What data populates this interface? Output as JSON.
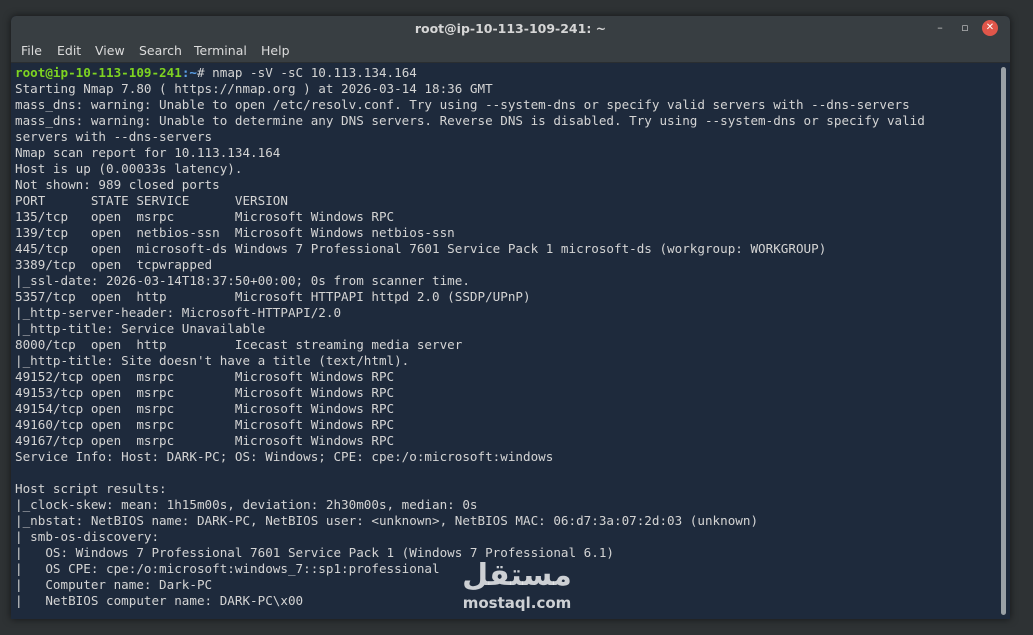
{
  "window": {
    "title": "root@ip-10-113-109-241: ~",
    "buttons": {
      "minimize": "–",
      "maximize": "▫",
      "close": "✕"
    }
  },
  "menu": [
    "File",
    "Edit",
    "View",
    "Search",
    "Terminal",
    "Help"
  ],
  "prompt": {
    "user_host": "root@ip-10-113-109-241",
    "path": ":~",
    "command": "# nmap -sV -sC 10.113.134.164"
  },
  "output": [
    "Starting Nmap 7.80 ( https://nmap.org ) at 2026-03-14 18:36 GMT",
    "mass_dns: warning: Unable to open /etc/resolv.conf. Try using --system-dns or specify valid servers with --dns-servers",
    "mass_dns: warning: Unable to determine any DNS servers. Reverse DNS is disabled. Try using --system-dns or specify valid",
    "servers with --dns-servers",
    "Nmap scan report for 10.113.134.164",
    "Host is up (0.00033s latency).",
    "Not shown: 989 closed ports",
    "PORT      STATE SERVICE      VERSION",
    "135/tcp   open  msrpc        Microsoft Windows RPC",
    "139/tcp   open  netbios-ssn  Microsoft Windows netbios-ssn",
    "445/tcp   open  microsoft-ds Windows 7 Professional 7601 Service Pack 1 microsoft-ds (workgroup: WORKGROUP)",
    "3389/tcp  open  tcpwrapped",
    "|_ssl-date: 2026-03-14T18:37:50+00:00; 0s from scanner time.",
    "5357/tcp  open  http         Microsoft HTTPAPI httpd 2.0 (SSDP/UPnP)",
    "|_http-server-header: Microsoft-HTTPAPI/2.0",
    "|_http-title: Service Unavailable",
    "8000/tcp  open  http         Icecast streaming media server",
    "|_http-title: Site doesn't have a title (text/html).",
    "49152/tcp open  msrpc        Microsoft Windows RPC",
    "49153/tcp open  msrpc        Microsoft Windows RPC",
    "49154/tcp open  msrpc        Microsoft Windows RPC",
    "49160/tcp open  msrpc        Microsoft Windows RPC",
    "49167/tcp open  msrpc        Microsoft Windows RPC",
    "Service Info: Host: DARK-PC; OS: Windows; CPE: cpe:/o:microsoft:windows",
    "",
    "Host script results:",
    "|_clock-skew: mean: 1h15m00s, deviation: 2h30m00s, median: 0s",
    "|_nbstat: NetBIOS name: DARK-PC, NetBIOS user: <unknown>, NetBIOS MAC: 06:d7:3a:07:2d:03 (unknown)",
    "| smb-os-discovery:",
    "|   OS: Windows 7 Professional 7601 Service Pack 1 (Windows 7 Professional 6.1)",
    "|   OS CPE: cpe:/o:microsoft:windows_7::sp1:professional",
    "|   Computer name: Dark-PC",
    "|   NetBIOS computer name: DARK-PC\\x00"
  ],
  "watermark": {
    "logo": "مستقل",
    "text": "mostaql.com"
  },
  "colors": {
    "terminal_bg": "#1e2a3c",
    "prompt_user": "#7ed321",
    "prompt_path": "#5ca0e6",
    "text": "#d4d4d4",
    "titlebar": "#383e42",
    "close_button": "#e0564a"
  }
}
